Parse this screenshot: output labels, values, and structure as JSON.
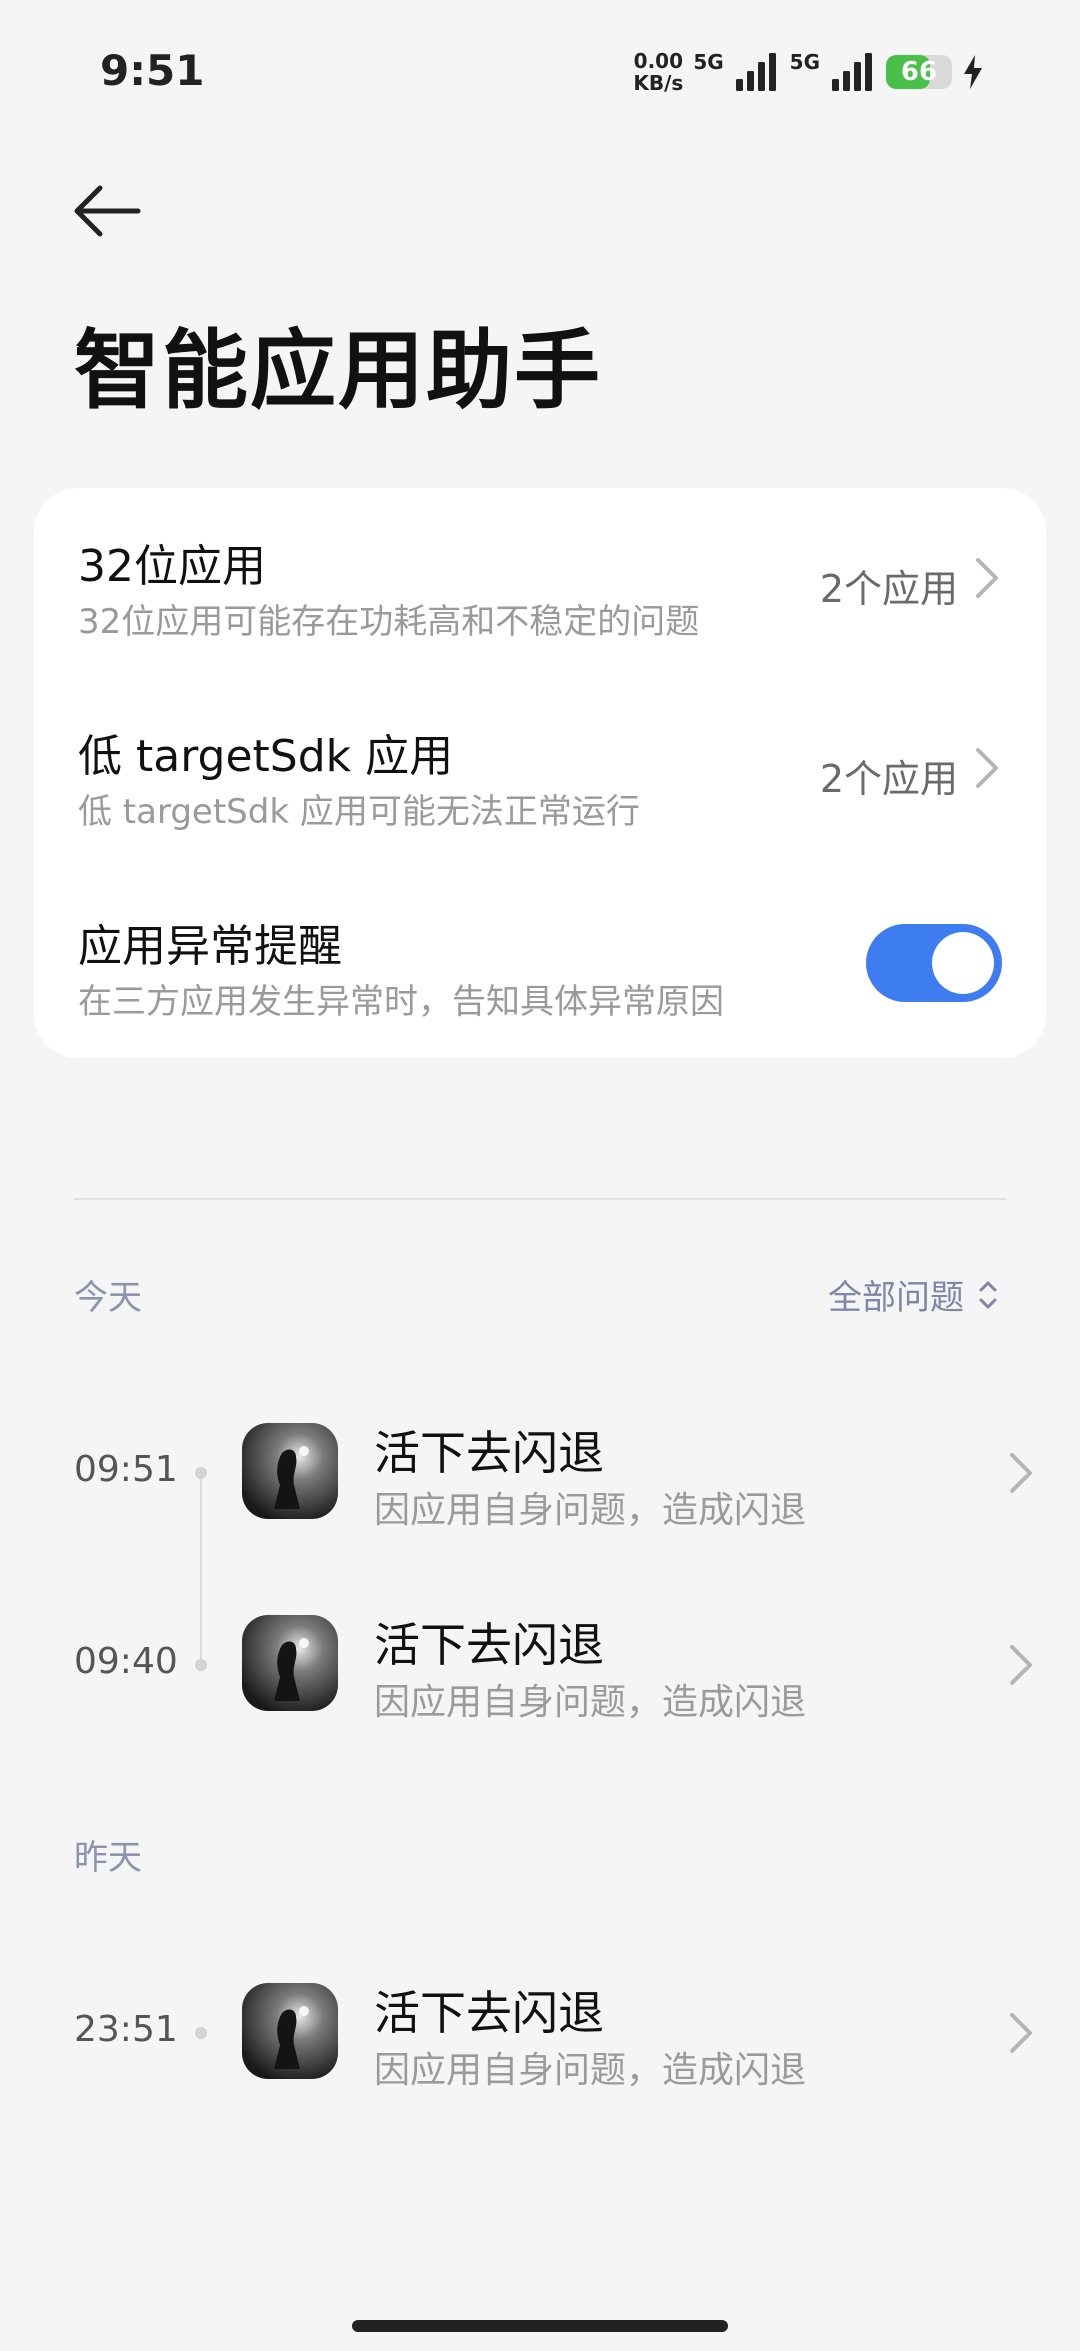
{
  "status_bar": {
    "time": "9:51",
    "speed_value": "0.00",
    "speed_unit": "KB/s",
    "network_1": "5G",
    "network_2": "5G",
    "battery": "66",
    "battery_level": 0.66
  },
  "header": {
    "title": "智能应用助手"
  },
  "settings": [
    {
      "title": "32位应用",
      "subtitle": "32位应用可能存在功耗高和不稳定的问题",
      "value": "2个应用"
    },
    {
      "title": "低 targetSdk 应用",
      "subtitle": "低 targetSdk 应用可能无法正常运行",
      "value": "2个应用"
    },
    {
      "title": "应用异常提醒",
      "subtitle": "在三方应用发生异常时，告知具体异常原因",
      "toggle_on": true
    }
  ],
  "filter": {
    "label": "全部问题"
  },
  "sections": [
    {
      "label": "今天",
      "items": [
        {
          "time": "09:51",
          "title": "活下去闪退",
          "subtitle": "因应用自身问题，造成闪退"
        },
        {
          "time": "09:40",
          "title": "活下去闪退",
          "subtitle": "因应用自身问题，造成闪退"
        }
      ]
    },
    {
      "label": "昨天",
      "items": [
        {
          "time": "23:51",
          "title": "活下去闪退",
          "subtitle": "因应用自身问题，造成闪退"
        }
      ]
    }
  ],
  "colors": {
    "accent": "#3e7cf2",
    "battery": "#48c04a",
    "section_label": "#8a93b0"
  }
}
